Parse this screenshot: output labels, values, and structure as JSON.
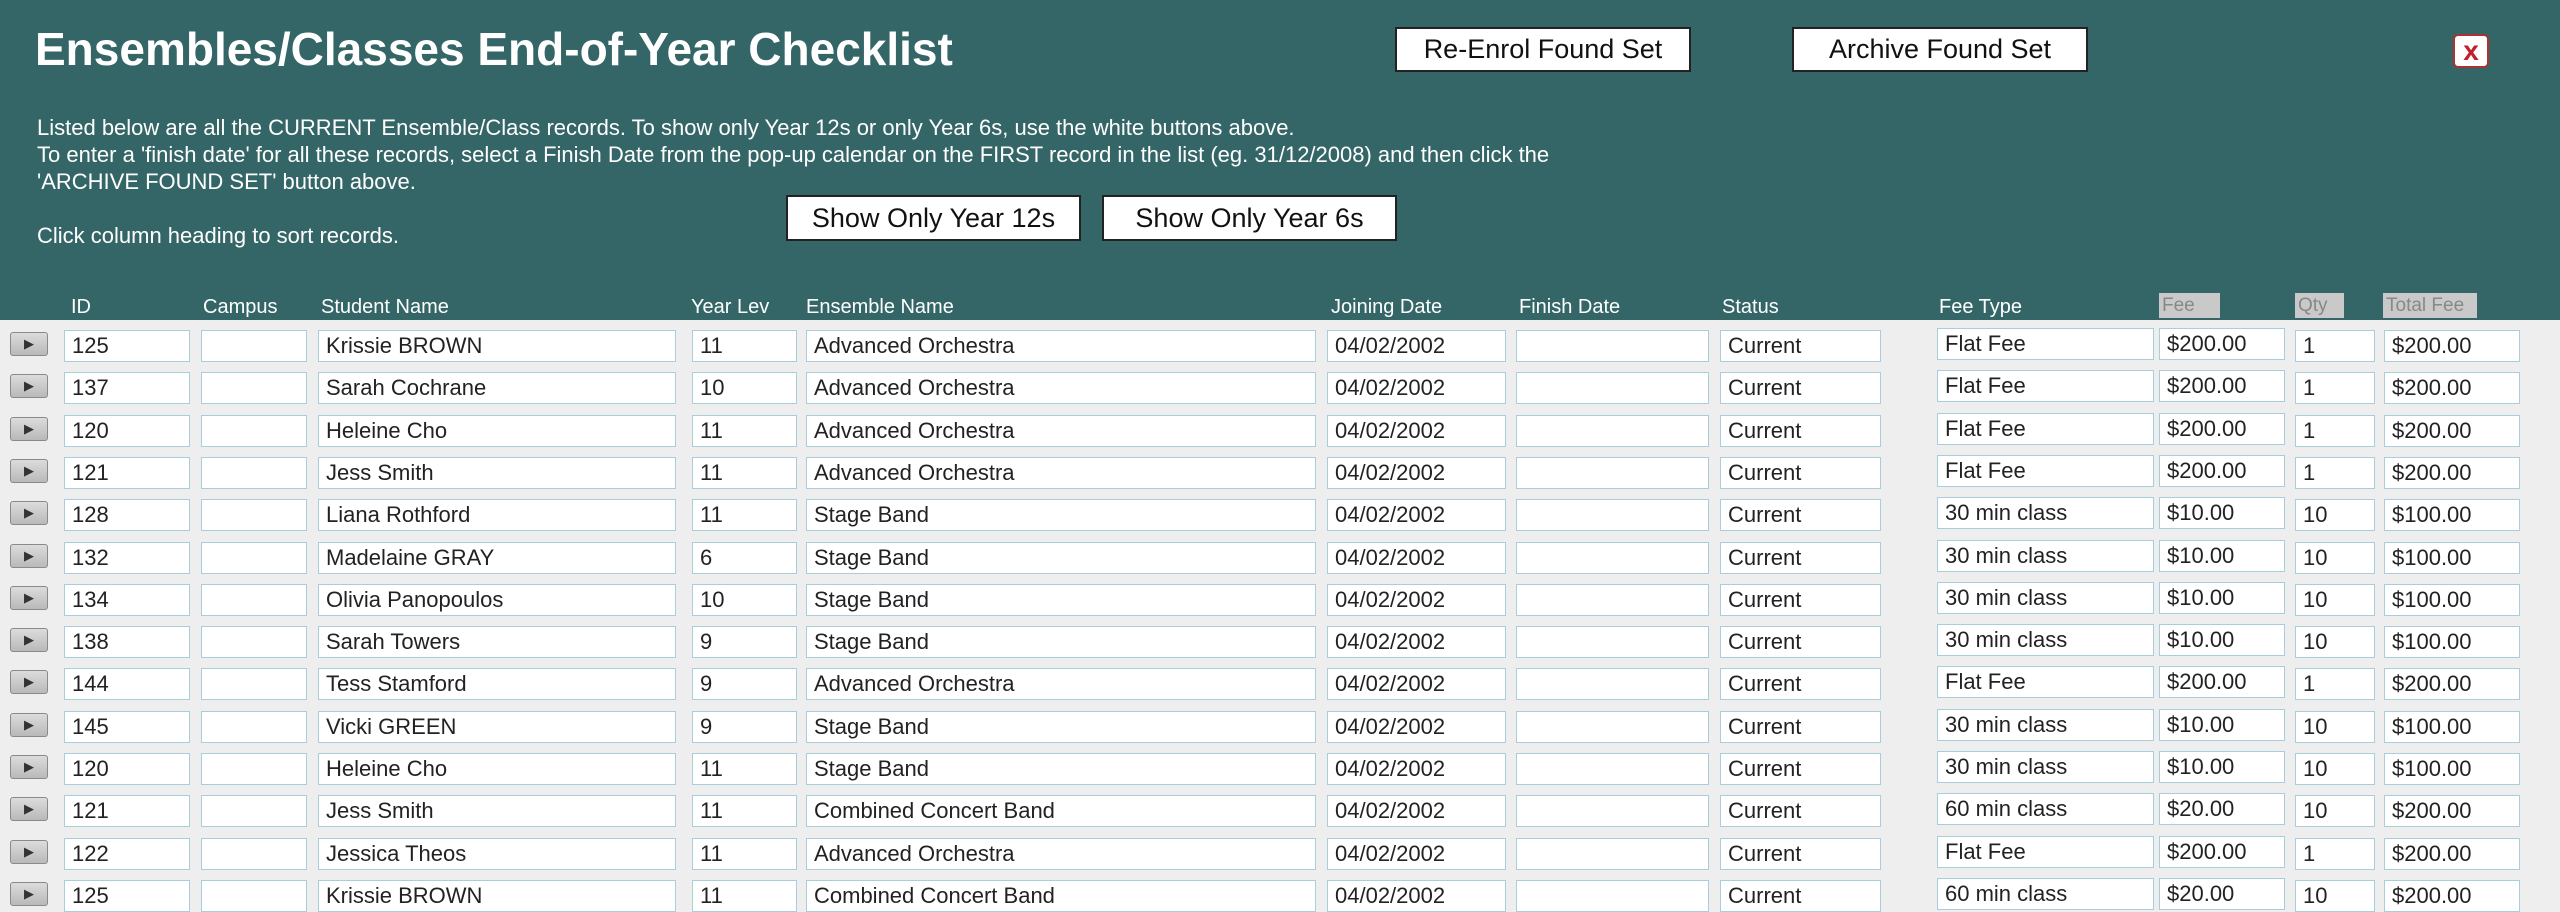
{
  "header": {
    "title": "Ensembles/Classes End-of-Year Checklist",
    "desc_line1": "Listed below are all the CURRENT Ensemble/Class  records.  To show only Year 12s or only Year 6s, use the white buttons above.",
    "desc_line2": "To enter a 'finish date' for all these records, select a Finish Date from the pop-up calendar on the FIRST record in the list (eg. 31/12/2008) and then click the",
    "desc_line3": "'ARCHIVE FOUND SET' button above.",
    "desc_line4": "Click column heading to sort records.",
    "reenrol_label": "Re-Enrol Found Set",
    "archive_label": "Archive Found Set",
    "show12_label": "Show Only Year 12s",
    "show6_label": "Show Only Year 6s",
    "close_label": "x"
  },
  "columns": {
    "id": "ID",
    "campus": "Campus",
    "student": "Student Name",
    "year": "Year Lev",
    "ensemble": "Ensemble Name",
    "joining": "Joining Date",
    "finish": "Finish Date",
    "status": "Status",
    "fee_type": "Fee Type",
    "fee": "Fee",
    "qty": "Qty",
    "total": "Total Fee"
  },
  "rows": [
    {
      "id": "125",
      "campus": "",
      "name": "Krissie BROWN",
      "year": "11",
      "ensemble": "Advanced Orchestra",
      "joining": "04/02/2002",
      "finish": "",
      "status": "Current",
      "fee_type": "Flat Fee",
      "fee": "$200.00",
      "qty": "1",
      "total": "$200.00"
    },
    {
      "id": "137",
      "campus": "",
      "name": "Sarah Cochrane",
      "year": "10",
      "ensemble": "Advanced Orchestra",
      "joining": "04/02/2002",
      "finish": "",
      "status": "Current",
      "fee_type": "Flat Fee",
      "fee": "$200.00",
      "qty": "1",
      "total": "$200.00"
    },
    {
      "id": "120",
      "campus": "",
      "name": "Heleine Cho",
      "year": "11",
      "ensemble": "Advanced Orchestra",
      "joining": "04/02/2002",
      "finish": "",
      "status": "Current",
      "fee_type": "Flat Fee",
      "fee": "$200.00",
      "qty": "1",
      "total": "$200.00"
    },
    {
      "id": "121",
      "campus": "",
      "name": "Jess Smith",
      "year": "11",
      "ensemble": "Advanced Orchestra",
      "joining": "04/02/2002",
      "finish": "",
      "status": "Current",
      "fee_type": "Flat Fee",
      "fee": "$200.00",
      "qty": "1",
      "total": "$200.00"
    },
    {
      "id": "128",
      "campus": "",
      "name": "Liana Rothford",
      "year": "11",
      "ensemble": "Stage Band",
      "joining": "04/02/2002",
      "finish": "",
      "status": "Current",
      "fee_type": "30 min class",
      "fee": "$10.00",
      "qty": "10",
      "total": "$100.00"
    },
    {
      "id": "132",
      "campus": "",
      "name": "Madelaine GRAY",
      "year": "6",
      "ensemble": "Stage Band",
      "joining": "04/02/2002",
      "finish": "",
      "status": "Current",
      "fee_type": "30 min class",
      "fee": "$10.00",
      "qty": "10",
      "total": "$100.00"
    },
    {
      "id": "134",
      "campus": "",
      "name": "Olivia Panopoulos",
      "year": "10",
      "ensemble": "Stage Band",
      "joining": "04/02/2002",
      "finish": "",
      "status": "Current",
      "fee_type": "30 min class",
      "fee": "$10.00",
      "qty": "10",
      "total": "$100.00"
    },
    {
      "id": "138",
      "campus": "",
      "name": "Sarah Towers",
      "year": "9",
      "ensemble": "Stage Band",
      "joining": "04/02/2002",
      "finish": "",
      "status": "Current",
      "fee_type": "30 min class",
      "fee": "$10.00",
      "qty": "10",
      "total": "$100.00"
    },
    {
      "id": "144",
      "campus": "",
      "name": "Tess Stamford",
      "year": "9",
      "ensemble": "Advanced Orchestra",
      "joining": "04/02/2002",
      "finish": "",
      "status": "Current",
      "fee_type": "Flat Fee",
      "fee": "$200.00",
      "qty": "1",
      "total": "$200.00"
    },
    {
      "id": "145",
      "campus": "",
      "name": "Vicki GREEN",
      "year": "9",
      "ensemble": "Stage Band",
      "joining": "04/02/2002",
      "finish": "",
      "status": "Current",
      "fee_type": "30 min class",
      "fee": "$10.00",
      "qty": "10",
      "total": "$100.00"
    },
    {
      "id": "120",
      "campus": "",
      "name": "Heleine Cho",
      "year": "11",
      "ensemble": "Stage Band",
      "joining": "04/02/2002",
      "finish": "",
      "status": "Current",
      "fee_type": "30 min class",
      "fee": "$10.00",
      "qty": "10",
      "total": "$100.00"
    },
    {
      "id": "121",
      "campus": "",
      "name": "Jess Smith",
      "year": "11",
      "ensemble": "Combined Concert Band",
      "joining": "04/02/2002",
      "finish": "",
      "status": "Current",
      "fee_type": "60 min class",
      "fee": "$20.00",
      "qty": "10",
      "total": "$200.00"
    },
    {
      "id": "122",
      "campus": "",
      "name": "Jessica Theos",
      "year": "11",
      "ensemble": "Advanced Orchestra",
      "joining": "04/02/2002",
      "finish": "",
      "status": "Current",
      "fee_type": "Flat Fee",
      "fee": "$200.00",
      "qty": "1",
      "total": "$200.00"
    },
    {
      "id": "125",
      "campus": "",
      "name": "Krissie BROWN",
      "year": "11",
      "ensemble": "Combined Concert Band",
      "joining": "04/02/2002",
      "finish": "",
      "status": "Current",
      "fee_type": "60 min class",
      "fee": "$20.00",
      "qty": "10",
      "total": "$200.00"
    }
  ]
}
